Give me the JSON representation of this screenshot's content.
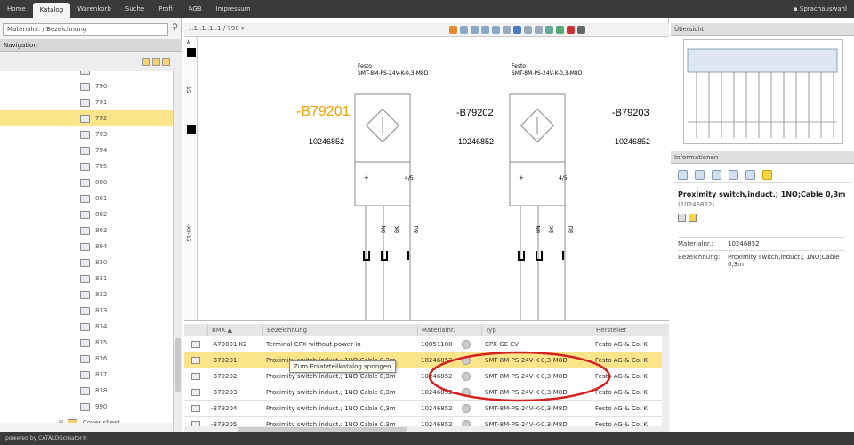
{
  "topnav": {
    "tabs": [
      "Home",
      "Katalog",
      "Warenkorb",
      "Suche",
      "Profil",
      "AGB",
      "Impressum"
    ],
    "active": "Katalog",
    "language": "Sprachauswahl"
  },
  "left": {
    "search_value": "Materialnr. / Bezeichnung",
    "nav_title": "Navigation",
    "tree_items": [
      "790",
      "791",
      "792",
      "793",
      "794",
      "795",
      "800",
      "801",
      "802",
      "803",
      "804",
      "830",
      "831",
      "832",
      "833",
      "834",
      "835",
      "836",
      "837",
      "838",
      "990"
    ],
    "selected": "792",
    "cover_label": "Cover sheet"
  },
  "center": {
    "page_path": "..1..1..1..1 / 790 ▾",
    "side_labels": [
      "A",
      "15",
      "-X9-15"
    ],
    "schematic": {
      "devices": [
        {
          "tag": "-B79201",
          "number": "10246852",
          "type_label": "Festo",
          "type_code": "SMT-8M-PS-24V-K-0,3-M8D",
          "highlight": true,
          "pins": [
            "BN",
            "BK",
            "BU"
          ]
        },
        {
          "tag": "-B79202",
          "number": "10246852",
          "type_label": "Festo",
          "type_code": "SMT-8M-PS-24V-K-0,3-M8D",
          "highlight": false,
          "pins": [
            "BN",
            "BK",
            "BU"
          ]
        },
        {
          "tag": "-B79203",
          "number": "10246852",
          "type_label": "",
          "type_code": "",
          "highlight": false,
          "pins": []
        }
      ]
    },
    "grid": {
      "headers": [
        "BMK ▲",
        "Bezeichnung",
        "Materialnr.",
        "Typ",
        "Hersteller"
      ],
      "rows": [
        {
          "bmk": "-A79001.K2",
          "bez": "Terminal CPX without power in",
          "mat": "10051100",
          "typ": "CPX-GE-EV",
          "her": "Festo AG & Co. K"
        },
        {
          "bmk": "-B79201",
          "bez": "Proximity switch,induct.; 1NO;Cable 0,3m",
          "mat": "10246852",
          "typ": "SMT-8M-PS-24V-K-0,3-M8D",
          "her": "Festo AG & Co. K"
        },
        {
          "bmk": "-B79202",
          "bez": "Proximity switch,induct.; 1NO;Cable 0,3m",
          "mat": "10246852",
          "typ": "SMT-8M-PS-24V-K-0,3-M8D",
          "her": "Festo AG & Co. K"
        },
        {
          "bmk": "-B79203",
          "bez": "Proximity switch,induct.; 1NO;Cable 0,3m",
          "mat": "10246852",
          "typ": "SMT-8M-PS-24V-K-0,3-M8D",
          "her": "Festo AG & Co. K"
        },
        {
          "bmk": "-B79204",
          "bez": "Proximity switch,induct.; 1NO;Cable 0,3m",
          "mat": "10246852",
          "typ": "SMT-8M-PS-24V-K-0,3-M8D",
          "her": "Festo AG & Co. K"
        },
        {
          "bmk": "-B79205",
          "bez": "Proximity switch,induct.; 1NO;Cable 0,3m",
          "mat": "10246852",
          "typ": "SMT-8M-PS-24V-K-0,3-M8D",
          "her": "Festo AG & Co. K"
        }
      ],
      "selected_row": 1
    },
    "tooltip": "Zum Ersatzteilkatalog springen"
  },
  "right": {
    "overview_title": "Übersicht",
    "info_title": "Informationen",
    "item_title": "Proximity switch,induct.; 1NO;Cable 0,3m",
    "item_sub": "(10246852)",
    "fields": [
      {
        "k": "Materialnr.:",
        "v": "10246852"
      },
      {
        "k": "Bezeichnung:",
        "v": "Proximity switch,induct.; 1NO;Cable 0,3m"
      }
    ]
  },
  "footer": "powered by CATALOGcreator®",
  "colors": {
    "highlight": "#fbe48a",
    "tag_orange": "#f0a000",
    "nav_bg": "#3a3a3a",
    "circle": "#d42020"
  }
}
